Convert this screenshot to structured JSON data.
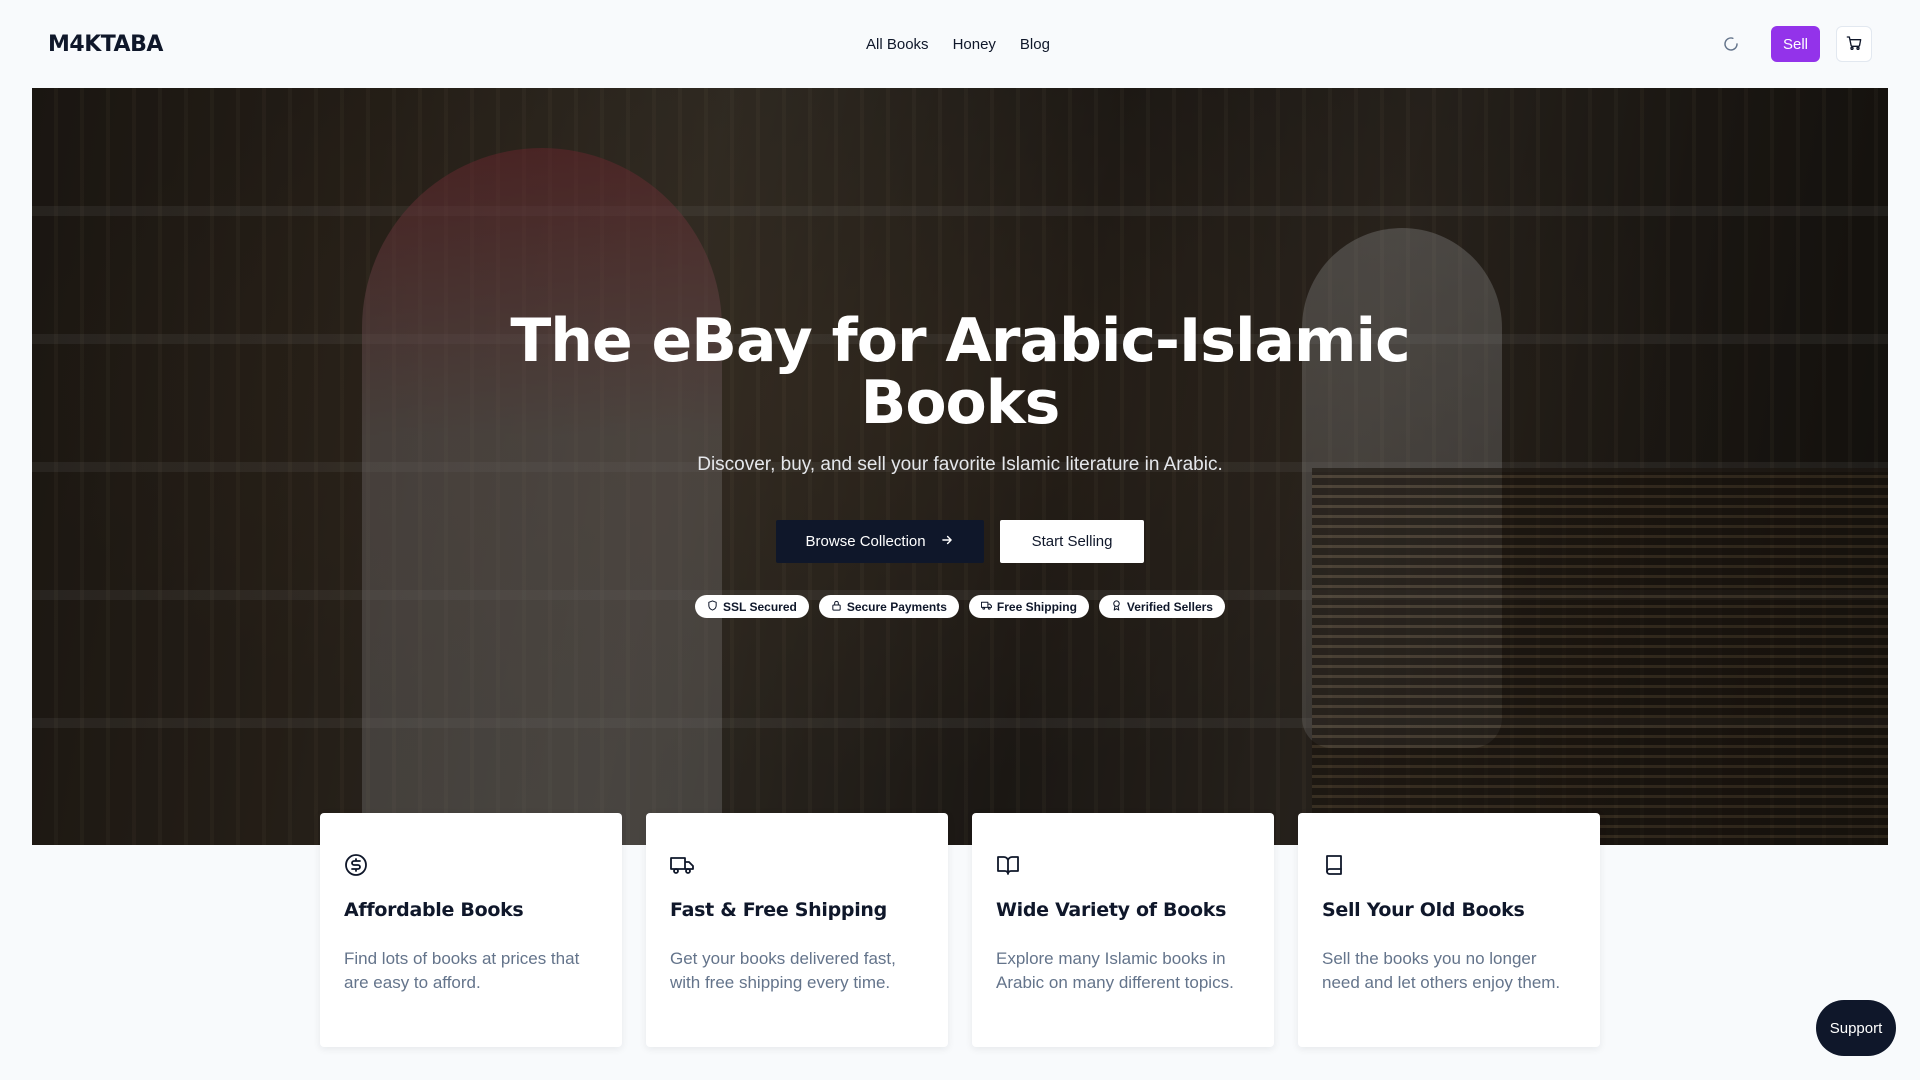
{
  "header": {
    "logo": "M4KTABA",
    "nav": [
      {
        "label": "All Books"
      },
      {
        "label": "Honey"
      },
      {
        "label": "Blog"
      }
    ],
    "sell_label": "Sell",
    "icons": {
      "loader": "loader-icon",
      "cart": "cart-icon"
    }
  },
  "hero": {
    "title": "The eBay for Arabic-Islamic Books",
    "subtitle": "Discover, buy, and sell your favorite Islamic literature in Arabic.",
    "browse_label": "Browse Collection",
    "start_label": "Start Selling",
    "badges": [
      {
        "label": "SSL Secured",
        "icon": "shield-icon"
      },
      {
        "label": "Secure Payments",
        "icon": "lock-icon"
      },
      {
        "label": "Free Shipping",
        "icon": "truck-icon"
      },
      {
        "label": "Verified Sellers",
        "icon": "award-icon"
      }
    ]
  },
  "features": [
    {
      "title": "Affordable Books",
      "description": "Find lots of books at prices that are easy to afford.",
      "icon": "dollar-circle-icon"
    },
    {
      "title": "Fast & Free Shipping",
      "description": "Get your books delivered fast, with free shipping every time.",
      "icon": "truck-icon"
    },
    {
      "title": "Wide Variety of Books",
      "description": "Explore many Islamic books in Arabic on many different topics.",
      "icon": "open-book-icon"
    },
    {
      "title": "Sell Your Old Books",
      "description": "Sell the books you no longer need and let others enjoy them.",
      "icon": "book-icon"
    }
  ],
  "support_label": "Support",
  "colors": {
    "accent": "#9333ea",
    "dark": "#0f172a",
    "muted": "#64748b"
  }
}
